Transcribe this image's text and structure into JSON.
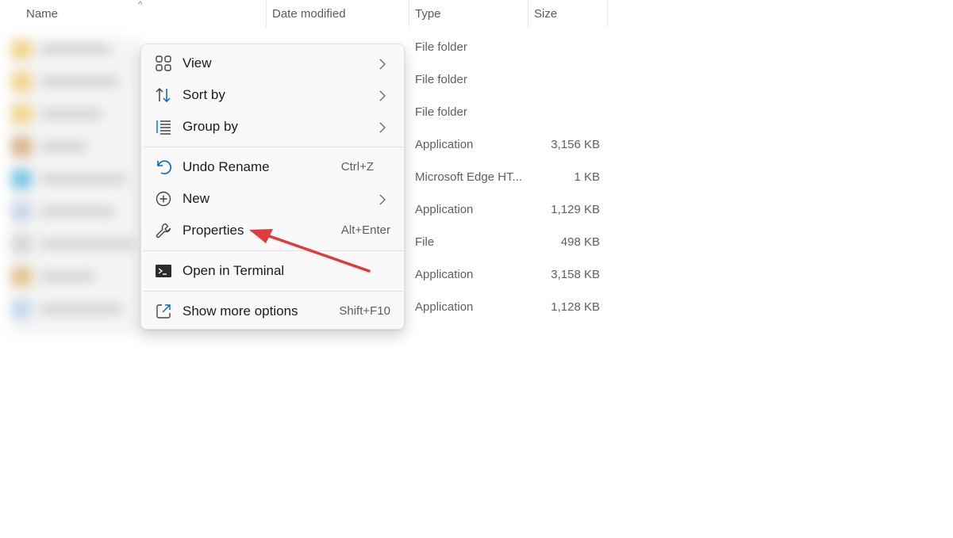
{
  "columns": {
    "name": "Name",
    "date_modified": "Date modified",
    "type": "Type",
    "size": "Size"
  },
  "rows": [
    {
      "type": "File folder",
      "size": ""
    },
    {
      "type": "File folder",
      "size": ""
    },
    {
      "type": "File folder",
      "size": ""
    },
    {
      "type": "Application",
      "size": "3,156 KB"
    },
    {
      "type": "Microsoft Edge HT...",
      "size": "1 KB"
    },
    {
      "type": "Application",
      "size": "1,129 KB"
    },
    {
      "type": "File",
      "size": "498 KB"
    },
    {
      "type": "Application",
      "size": "3,158 KB"
    },
    {
      "type": "Application",
      "size": "1,128 KB"
    }
  ],
  "context_menu": {
    "items": [
      {
        "label": "View",
        "icon": "grid-view-icon",
        "has_submenu": true,
        "shortcut": ""
      },
      {
        "label": "Sort by",
        "icon": "sort-arrows-icon",
        "has_submenu": true,
        "shortcut": ""
      },
      {
        "label": "Group by",
        "icon": "group-list-icon",
        "has_submenu": true,
        "shortcut": ""
      },
      {
        "label": "Undo Rename",
        "icon": "undo-icon",
        "has_submenu": false,
        "shortcut": "Ctrl+Z"
      },
      {
        "label": "New",
        "icon": "plus-circle-icon",
        "has_submenu": true,
        "shortcut": ""
      },
      {
        "label": "Properties",
        "icon": "wrench-icon",
        "has_submenu": false,
        "shortcut": "Alt+Enter"
      },
      {
        "label": "Open in Terminal",
        "icon": "terminal-icon",
        "has_submenu": false,
        "shortcut": ""
      },
      {
        "label": "Show more options",
        "icon": "share-external-icon",
        "has_submenu": false,
        "shortcut": "Shift+F10"
      }
    ]
  },
  "annotation": {
    "color": "#e03a3a",
    "points_to": "Properties"
  },
  "colors": {
    "accent": "#0067c0",
    "menu_bg": "#f9f9f9"
  }
}
